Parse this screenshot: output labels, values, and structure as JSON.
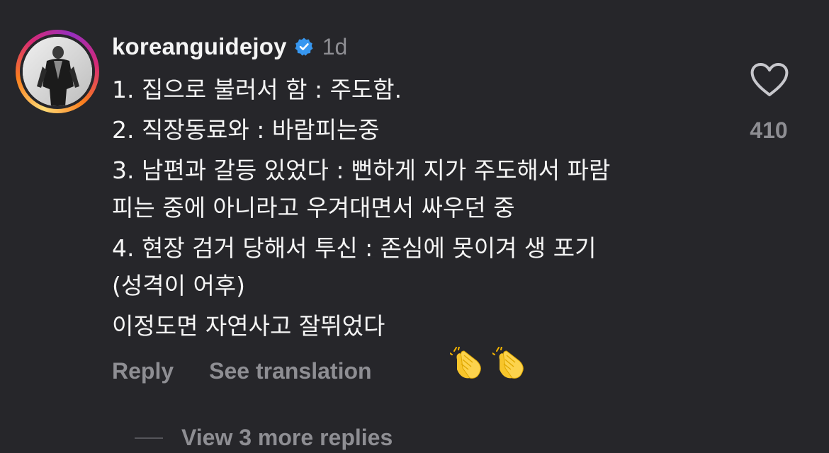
{
  "comment": {
    "username": "koreanguidejoy",
    "timestamp": "1d",
    "verified": true,
    "lines": [
      "1. 집으로 불러서 함 : 주도함.",
      "2. 직장동료와 : 바람피는중",
      "3. 남편과 갈등 있었다 : 뻔하게 지가 주도해서 파람",
      "피는 중에 아니라고 우겨대면서 싸우던 중",
      "4. 현장 검거 당해서 투신 : 존심에 못이겨 생 포기",
      "(성격이 어후)",
      "이정도면 자연사고 잘뛰었다"
    ],
    "emoji": [
      "clapping-hands",
      "clapping-hands"
    ]
  },
  "actions": {
    "reply_label": "Reply",
    "translate_label": "See translation"
  },
  "replies": {
    "view_label": "View 3 more replies"
  },
  "likes": {
    "count": "410",
    "icon": "heart-outline-icon"
  },
  "colors": {
    "background": "#26262a",
    "text": "#f5f5f5",
    "muted": "#8e8e93",
    "verified": "#3797f0"
  }
}
